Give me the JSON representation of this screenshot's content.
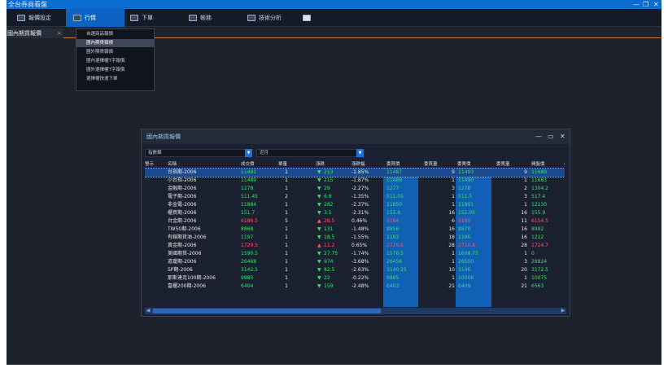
{
  "app": {
    "title": "全台券商看盤",
    "controls": {
      "minimize": "—",
      "restore": "❐",
      "close": "✕"
    }
  },
  "menu": [
    {
      "label": "報價設定",
      "icon": "monitor-icon"
    },
    {
      "label": "行情",
      "icon": "quote-icon"
    },
    {
      "label": "下單",
      "icon": "order-icon"
    },
    {
      "label": "帳務",
      "icon": "account-icon"
    },
    {
      "label": "技術分析",
      "icon": "chart-icon"
    },
    {
      "label": "",
      "icon": "grid-icon"
    }
  ],
  "tab": {
    "label": "國內期貨報價",
    "close": "×"
  },
  "dropdown": [
    "自選商品報價",
    "國內期貨報價",
    "國外期貨報價",
    "國內選擇權T字報價",
    "國外選擇權T字報價",
    "選擇權快速下單"
  ],
  "window": {
    "title": "國內期貨報價",
    "filter1": "指數類",
    "filter2": "近月",
    "headers": [
      "警示",
      "名稱",
      "成交價",
      "單量",
      "漲跌",
      "漲跌幅",
      "委買價",
      "委買量",
      "委賣價",
      "委賣量",
      "開盤價",
      "最"
    ],
    "rows": [
      [
        "台指期-2006",
        "11491",
        "1",
        "▼",
        "213",
        "-1.85%",
        "11487",
        "9",
        "11493",
        "9",
        "11689"
      ],
      [
        "小台指-2006",
        "11489",
        "1",
        "▼",
        "215",
        "-1.87%",
        "11488",
        "1",
        "11490",
        "1",
        "11683"
      ],
      [
        "金融期-2006",
        "1278",
        "1",
        "▼",
        "29",
        "-2.27%",
        "1277",
        "3",
        "1278",
        "2",
        "1304.2"
      ],
      [
        "電子期-2006",
        "511.45",
        "2",
        "▼",
        "6.9",
        "-1.35%",
        "511.05",
        "1",
        "511.5",
        "3",
        "517.4"
      ],
      [
        "非金電-2006",
        "11884",
        "1",
        "▼",
        "282",
        "-2.37%",
        "11850",
        "1",
        "11891",
        "1",
        "12130"
      ],
      [
        "櫃買期-2006",
        "151.7",
        "1",
        "▼",
        "3.5",
        "-2.31%",
        "151.8",
        "16",
        "152.05",
        "16",
        "155.9"
      ],
      [
        "台金期-2006",
        "6186.5",
        "5",
        "▲",
        "28.5",
        "0.46%",
        "6184",
        "6",
        "6189",
        "11",
        "6154.5"
      ],
      [
        "TW50期-2006",
        "8868",
        "1",
        "▼",
        "131",
        "-1.48%",
        "8856",
        "16",
        "8870",
        "16",
        "8992"
      ],
      [
        "有線期貨油-2006",
        "1197",
        "1",
        "▼",
        "18.5",
        "-1.55%",
        "1193",
        "18",
        "1196",
        "16",
        "1212"
      ],
      [
        "黃金期-2006",
        "1729.5",
        "1",
        "▲",
        "11.2",
        "0.65%",
        "1729.6",
        "28",
        "1730.8",
        "28",
        "1724.7"
      ],
      [
        "美國期貨-2006",
        "1590.5",
        "1",
        "▼",
        "27.75",
        "-1.74%",
        "1570.5",
        "1",
        "1608.75",
        "1",
        "0"
      ],
      [
        "道瓊期-2006",
        "26468",
        "1",
        "▼",
        "974",
        "-3.68%",
        "26456",
        "1",
        "26500",
        "3",
        "26824"
      ],
      [
        "SP期-2006",
        "3142.5",
        "1",
        "▼",
        "82.5",
        "-2.63%",
        "3140.25",
        "10",
        "3146",
        "20",
        "3172.5"
      ],
      [
        "那斯達克100期-2006",
        "9885",
        "1",
        "▼",
        "22",
        "-0.22%",
        "9885",
        "1",
        "10008",
        "1",
        "10075"
      ],
      [
        "富櫃200期-2006",
        "6404",
        "1",
        "▼",
        "159",
        "-2.48%",
        "6403",
        "21",
        "6409",
        "21",
        "6563"
      ]
    ]
  },
  "colors": {
    "up": "#ff5468",
    "down": "#35e06a",
    "accent": "#0c63c2"
  }
}
